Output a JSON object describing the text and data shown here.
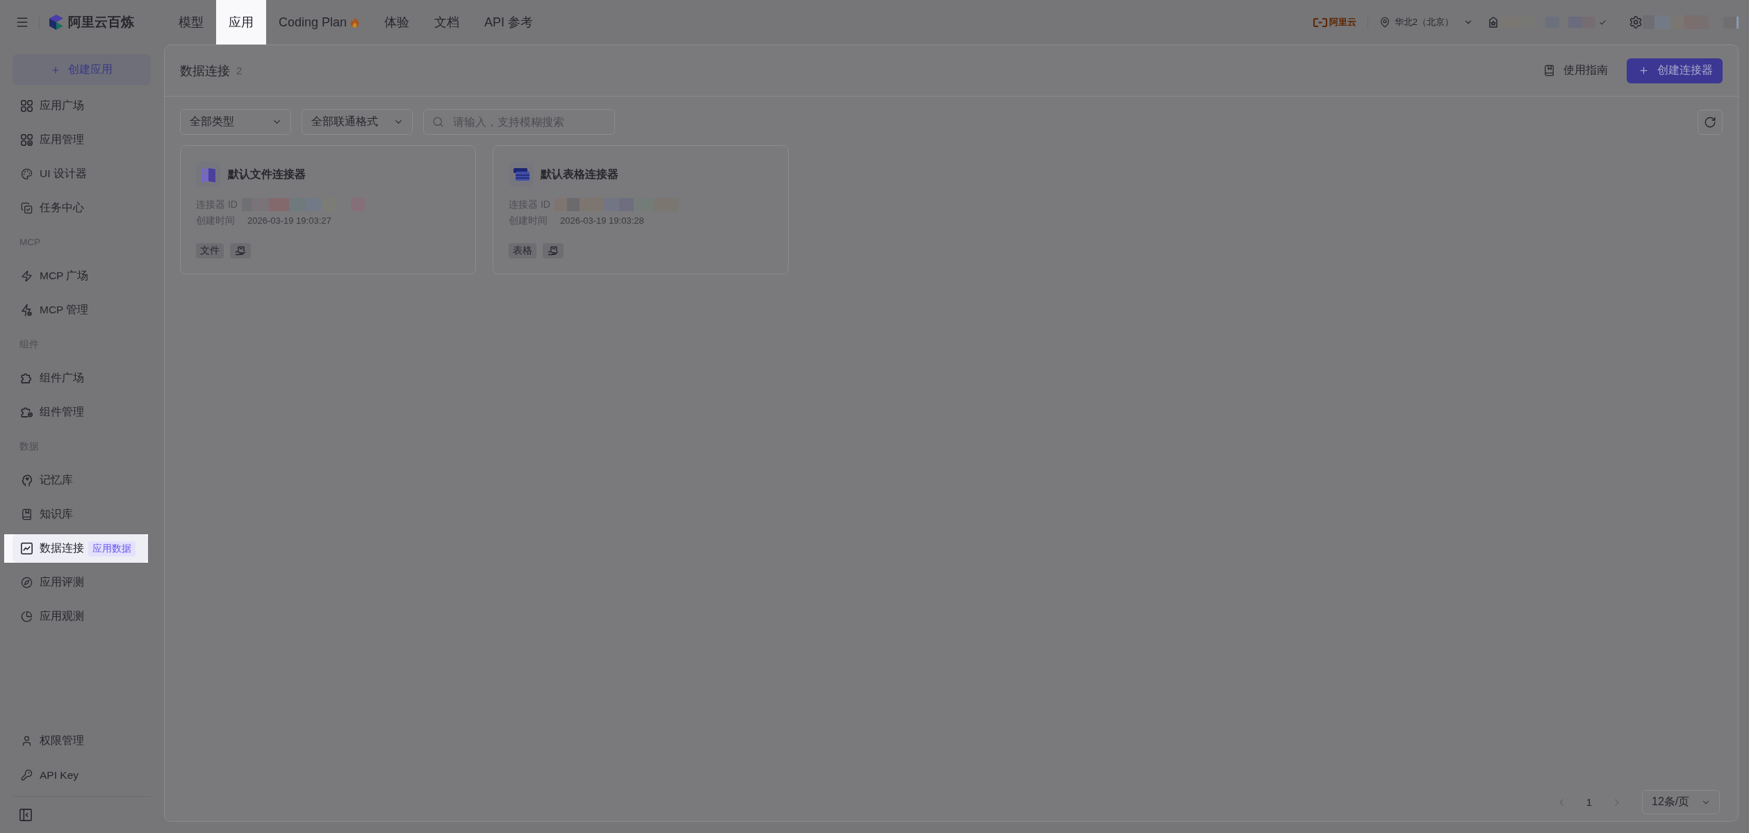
{
  "overlay": true,
  "topbar": {
    "brand": "阿里云百炼",
    "nav": [
      {
        "label": "模型",
        "selected": false,
        "hot": false
      },
      {
        "label": "应用",
        "selected": true,
        "hot": false
      },
      {
        "label": "Coding Plan",
        "selected": false,
        "hot": true
      },
      {
        "label": "体验",
        "selected": false,
        "hot": false
      },
      {
        "label": "文档",
        "selected": false,
        "hot": false
      },
      {
        "label": "API 参考",
        "selected": false,
        "hot": false
      }
    ],
    "account": {
      "cloud_brand": "阿里云",
      "region": "华北2（北京）"
    }
  },
  "sidebar": {
    "create_button": "创建应用",
    "groups": [
      {
        "items": [
          {
            "label": "应用广场",
            "selected": false
          },
          {
            "label": "应用管理",
            "selected": false
          },
          {
            "label": "UI 设计器",
            "selected": false
          },
          {
            "label": "任务中心",
            "selected": false
          }
        ]
      },
      {
        "title": "MCP",
        "items": [
          {
            "label": "MCP 广场",
            "selected": false
          },
          {
            "label": "MCP 管理",
            "selected": false
          }
        ]
      },
      {
        "title": "组件",
        "items": [
          {
            "label": "组件广场",
            "selected": false
          },
          {
            "label": "组件管理",
            "selected": false
          }
        ]
      },
      {
        "title": "数据",
        "items": [
          {
            "label": "记忆库",
            "selected": false
          },
          {
            "label": "知识库",
            "selected": false
          },
          {
            "label": "数据连接",
            "selected": true,
            "badge": "应用数据"
          },
          {
            "label": "应用评测",
            "selected": false
          },
          {
            "label": "应用观测",
            "selected": false
          }
        ]
      }
    ],
    "footer": [
      {
        "label": "权限管理",
        "selected": false
      },
      {
        "label": "API Key",
        "selected": false
      }
    ]
  },
  "page": {
    "title": "数据连接",
    "count": "2",
    "guide": "使用指南",
    "create_button": "创建连接器"
  },
  "filters": {
    "type": "全部类型",
    "format": "全部联通格式",
    "search": {
      "placeholder": "请输入，支持模糊搜索"
    }
  },
  "connectors": [
    {
      "kind": "file",
      "name": "默认文件连接器",
      "id_label": "连接器 ID",
      "created_label": "创建时间",
      "created": "2026-03-19 19:03:27",
      "tag": "文件"
    },
    {
      "kind": "table",
      "name": "默认表格连接器",
      "id_label": "连接器 ID",
      "created_label": "创建时间",
      "created": "2026-03-19 19:03:28",
      "tag": "表格"
    }
  ],
  "pagination": {
    "prev_disabled": true,
    "pages": [
      {
        "label": "1",
        "selected": true
      }
    ],
    "next_disabled": true,
    "page_size": "12条/页"
  }
}
